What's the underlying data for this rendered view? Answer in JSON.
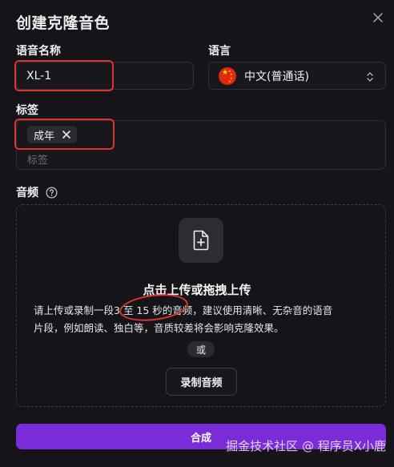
{
  "dialog": {
    "title": "创建克隆音色",
    "close_icon": "close-icon"
  },
  "voice_name": {
    "label": "语音名称",
    "value": "XL-1"
  },
  "language": {
    "label": "语言",
    "selected": "中文(普通话)",
    "flag_icon": "china-flag-icon",
    "chevron_icon": "chevron-updown-icon"
  },
  "tags": {
    "label": "标签",
    "items": [
      "成年"
    ],
    "placeholder": "标签"
  },
  "audio": {
    "label": "音频",
    "help_icon": "help-circle-icon",
    "upload_icon": "file-plus-icon",
    "upload_title": "点击上传或拖拽上传",
    "hint_line1_a": "请上传或录制一段",
    "hint_highlight": "3 至 15 秒",
    "hint_line1_b": "的音频，建议使用清晰、无杂音的语音",
    "hint_line2": "片段，例如朗读、独白等，音质较差将会影响克隆效果。",
    "or_label": "或",
    "record_label": "录制音频"
  },
  "submit_label": "合成",
  "watermark": "掘金技术社区 @ 程序员X小鹿",
  "colors": {
    "background": "#141419",
    "accent": "#7B2CD9",
    "annotation_red": "#E0332F"
  }
}
